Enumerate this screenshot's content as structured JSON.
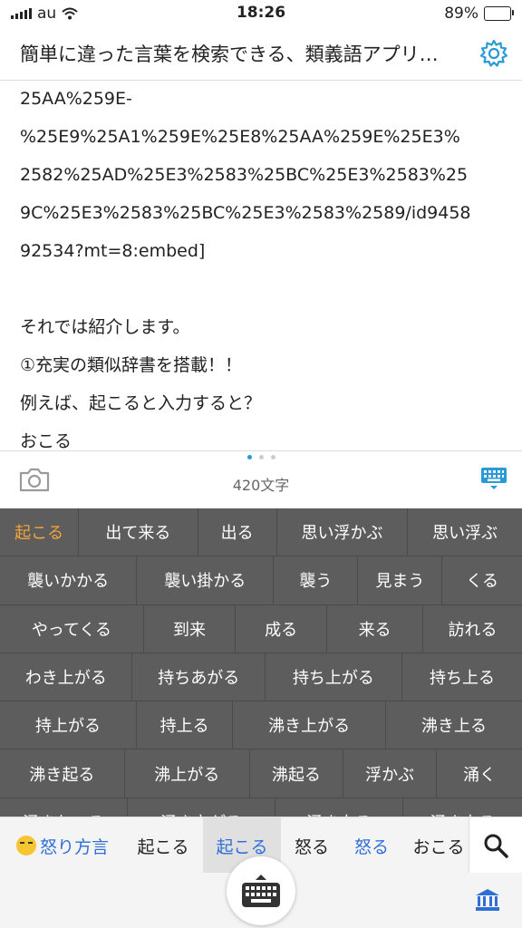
{
  "status": {
    "carrier": "au",
    "time": "18:26",
    "battery": "89%",
    "battery_level": 0.89
  },
  "header": {
    "title": "簡単に違った言葉を検索できる、類義語アプリ…"
  },
  "document": {
    "lines": [
      "25AA%259E-",
      "%25E9%25A1%259E%25E8%25AA%259E%25E3%",
      "2582%25AD%25E3%2583%25BC%25E3%2583%25",
      "9C%25E3%2583%25BC%25E3%2583%2589/id9458",
      "92534?mt=8:embed]",
      "",
      "それでは紹介します。",
      "①充実の類似辞書を搭載！！",
      "例えば、起こると入力すると？",
      "おこる"
    ]
  },
  "meta": {
    "char_count": "420文字"
  },
  "suggestions": {
    "rows": [
      [
        "起こる",
        "出て来る",
        "出る",
        "思い浮かぶ",
        "思い浮ぶ"
      ],
      [
        "襲いかかる",
        "襲い掛かる",
        "襲う",
        "見まう",
        "くる"
      ],
      [
        "やってくる",
        "到来",
        "成る",
        "来る",
        "訪れる"
      ],
      [
        "わき上がる",
        "持ちあがる",
        "持ち上がる",
        "持ち上る"
      ],
      [
        "持上がる",
        "持上る",
        "沸き上がる",
        "沸き上る"
      ],
      [
        "沸き起る",
        "沸上がる",
        "沸起る",
        "浮かぶ",
        "涌く"
      ],
      [
        "涌きおこる",
        "涌き上がる",
        "涌き上る",
        "涌き上る"
      ]
    ],
    "selected": "起こる"
  },
  "candidates": {
    "emoji_label": "怒り方言",
    "items": [
      "起こる",
      "起こる",
      "怒る",
      "怒る",
      "おこる"
    ]
  },
  "icons": {
    "gear": "gear-icon",
    "camera": "camera-icon",
    "keyboard_toggle": "keyboard-icon",
    "search": "search-icon",
    "bank": "bank-icon",
    "wifi": "wifi-icon"
  },
  "colors": {
    "accent": "#2a9ad6",
    "selected": "#f5a33a",
    "link_blue": "#2f6fd6",
    "grid_bg": "#5d5d5d"
  }
}
